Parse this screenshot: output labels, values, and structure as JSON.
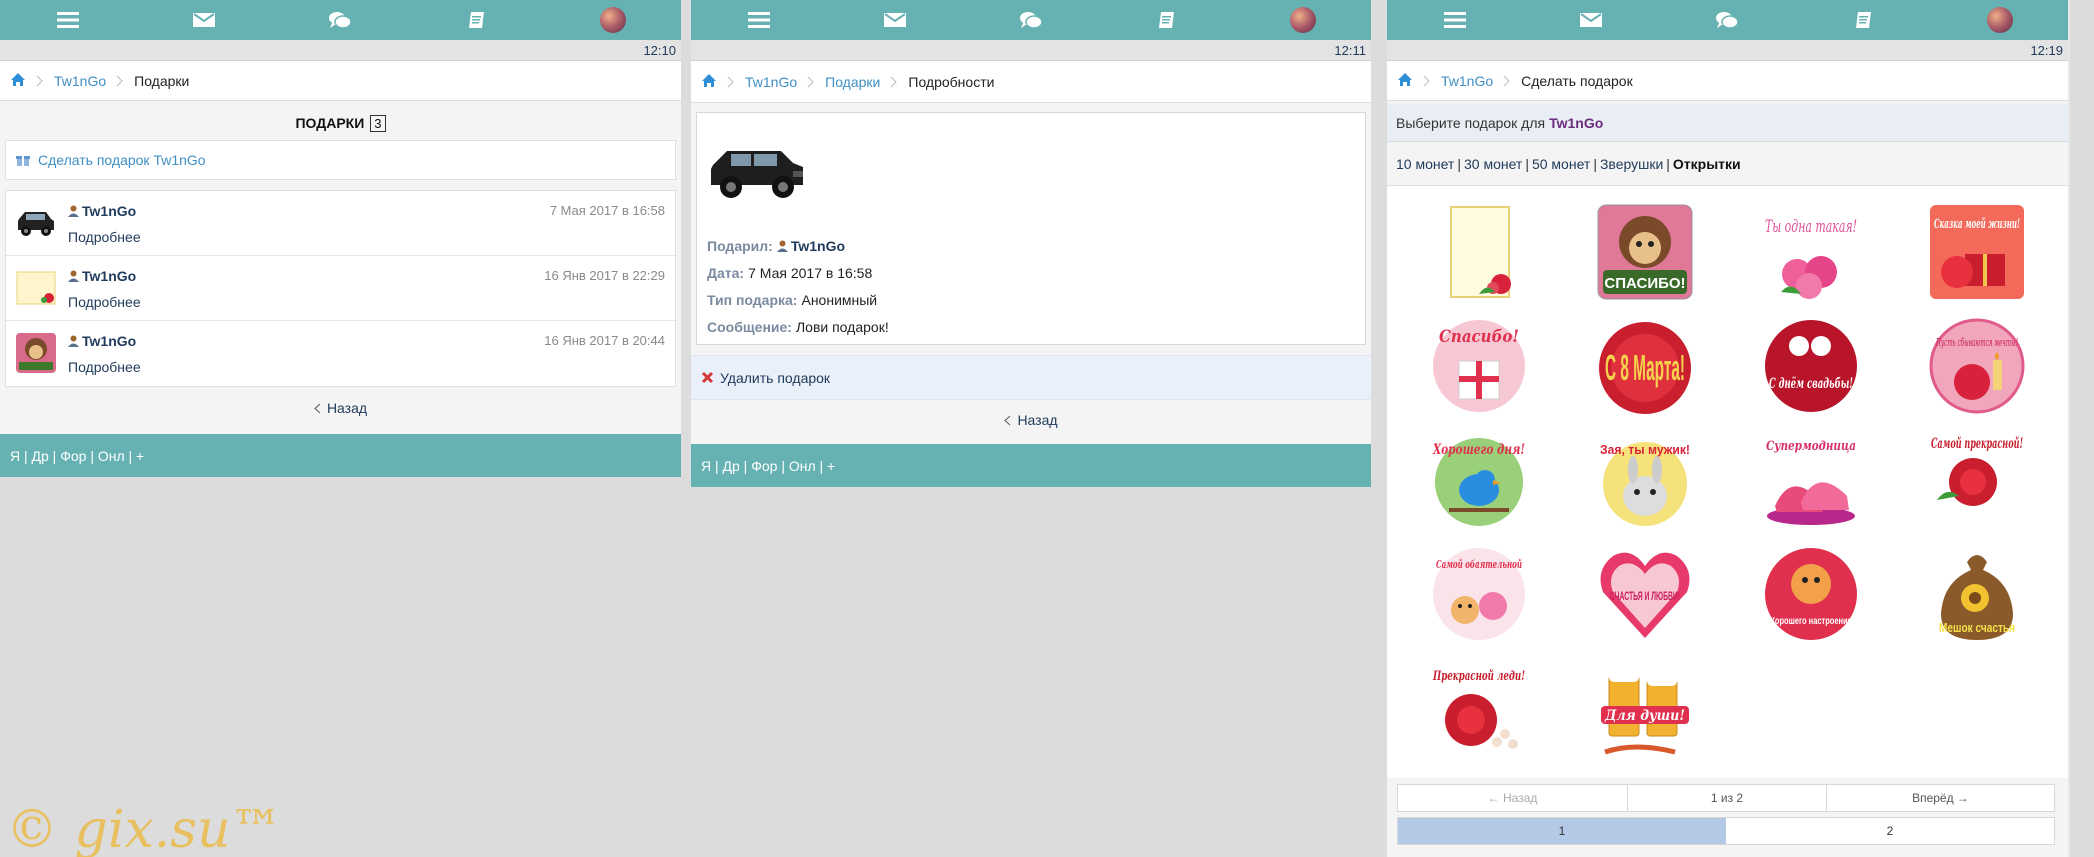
{
  "colors": {
    "teal": "#66b2b2",
    "link": "#3f8fc4",
    "dark": "#1f3a5a",
    "accent_name": "#6b2c7e",
    "watermark": "#e8c060"
  },
  "nav_icons": [
    "menu-icon",
    "mail-icon",
    "chat-icon",
    "journal-icon",
    "avatar"
  ],
  "panel1": {
    "time": "12:10",
    "breadcrumb": {
      "user": "Tw1nGo",
      "current": "Подарки"
    },
    "title": "ПОДАРКИ",
    "count": "3",
    "make_gift": "Сделать подарок Tw1nGo",
    "gifts": [
      {
        "user": "Tw1nGo",
        "date": "7 Мая 2017 в 16:58",
        "more": "Подробнее",
        "thumb": "black-suv"
      },
      {
        "user": "Tw1nGo",
        "date": "16 Янв 2017 в 22:29",
        "more": "Подробнее",
        "thumb": "rose-card"
      },
      {
        "user": "Tw1nGo",
        "date": "16 Янв 2017 в 20:44",
        "more": "Подробнее",
        "thumb": "hedgehog-thanks"
      }
    ],
    "back": "Назад",
    "footer": "Я | Др | Фор | Онл | +"
  },
  "panel2": {
    "time": "12:11",
    "breadcrumb": {
      "user": "Tw1nGo",
      "section": "Подарки",
      "current": "Подробности"
    },
    "gift_from_label": "Подарил:",
    "gift_from_user": "Tw1nGo",
    "date_label": "Дата:",
    "date_value": "7 Мая 2017 в 16:58",
    "type_label": "Тип подарка:",
    "type_value": "Анонимный",
    "message_label": "Сообщение:",
    "message_value": "Лови подарок!",
    "delete": "Удалить подарок",
    "back": "Назад",
    "footer": "Я | Др | Фор | Онл | +"
  },
  "panel3": {
    "time": "12:19",
    "breadcrumb": {
      "user": "Tw1nGo",
      "current": "Сделать подарок"
    },
    "choose_prefix": "Выберите подарок для",
    "choose_user": "Tw1nGo",
    "categories": [
      "10 монет",
      "30 монет",
      "50 монет",
      "Зверушки"
    ],
    "current_category": "Открытки",
    "gifts": [
      {
        "name": "rose-card",
        "text": ""
      },
      {
        "name": "hedgehog-thanks",
        "text": "СПАСИБО!"
      },
      {
        "name": "ty-odna-takaya",
        "text": "Ты одна такая!"
      },
      {
        "name": "skazka-moei-zhizni",
        "text": "Сказка моей жизни!"
      },
      {
        "name": "spasibo-gift",
        "text": "Спасибо!"
      },
      {
        "name": "8-marta",
        "text": "С 8 Марта!"
      },
      {
        "name": "s-dnem-svadby",
        "text": "С днём свадьбы!"
      },
      {
        "name": "pust-sbyvayutsya-mechty",
        "text": "Пусть сбываются мечты!"
      },
      {
        "name": "khoroshego-dnya",
        "text": "Хорошего дня!"
      },
      {
        "name": "zaya-ty-muzhik",
        "text": "Зая, ты мужик!"
      },
      {
        "name": "supermodnitsa",
        "text": "Супермодница"
      },
      {
        "name": "samoi-prekrasnoi",
        "text": "Самой прекрасной!"
      },
      {
        "name": "samoi-obayatelnoi",
        "text": "Самой обаятельной"
      },
      {
        "name": "schastya-i-lyubvi",
        "text": "СЧАСТЬЯ И ЛЮБВИ!"
      },
      {
        "name": "khoroshego-nastroeniya",
        "text": "Хорошего настроения"
      },
      {
        "name": "meshok-schastya",
        "text": "Мешок счастья"
      },
      {
        "name": "prekrasnoi-ledi",
        "text": "Прекрасной леди!"
      },
      {
        "name": "dlya-dushi",
        "text": "Для души!"
      }
    ],
    "pager": {
      "prev": "← Назад",
      "info": "1 из 2",
      "next": "Вперёд →"
    },
    "pages": [
      "1",
      "2"
    ]
  },
  "watermark": "© gix.su™"
}
